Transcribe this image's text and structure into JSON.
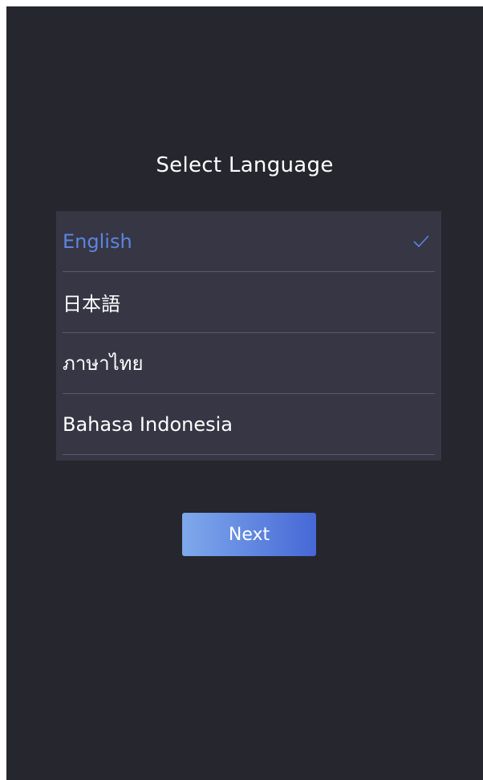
{
  "screen": {
    "title": "Select Language"
  },
  "languages": {
    "selected_index": 0,
    "items": [
      {
        "label": "English",
        "selected": true
      },
      {
        "label": "日本語",
        "selected": false
      },
      {
        "label": "ภาษาไทย",
        "selected": false
      },
      {
        "label": "Bahasa Indonesia",
        "selected": false
      }
    ]
  },
  "actions": {
    "next_label": "Next"
  },
  "colors": {
    "background": "#26262e",
    "list_background": "#363645",
    "accent": "#5b85e0",
    "button_gradient_start": "#7fa9ec",
    "button_gradient_end": "#4668d6"
  },
  "icons": {
    "selected_marker": "checkmark-icon"
  }
}
